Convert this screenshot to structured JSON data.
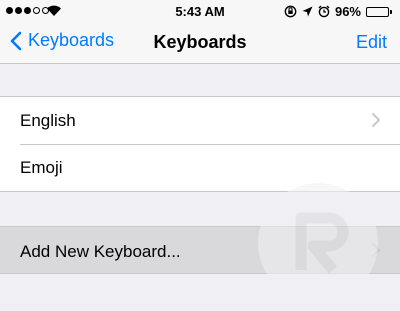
{
  "status_bar": {
    "time": "5:43 AM",
    "battery_text": "96%",
    "battery_level": 0.96,
    "signal_bars_filled": 3,
    "signal_bars_total": 5
  },
  "nav": {
    "back_label": "Keyboards",
    "title": "Keyboards",
    "edit_label": "Edit"
  },
  "keyboards": [
    {
      "label": "English",
      "has_chevron": true
    },
    {
      "label": "Emoji",
      "has_chevron": false
    }
  ],
  "add_keyboard": {
    "label": "Add New Keyboard..."
  },
  "colors": {
    "accent": "#007aff",
    "background": "#efeff4",
    "separator": "#c8c7cc",
    "highlight_row": "#d9d9dc"
  }
}
